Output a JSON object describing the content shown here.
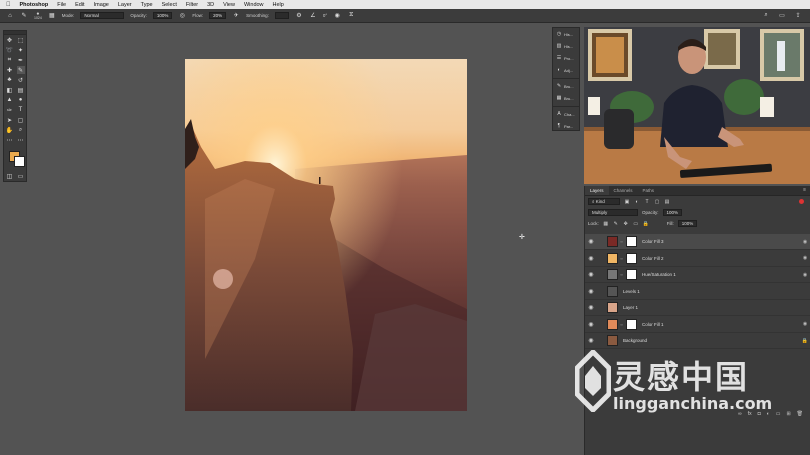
{
  "menubar": {
    "app": "Photoshop",
    "items": [
      "File",
      "Edit",
      "Image",
      "Layer",
      "Type",
      "Select",
      "Filter",
      "3D",
      "View",
      "Window",
      "Help"
    ]
  },
  "options": {
    "brush_size": "1024",
    "mode_label": "Mode:",
    "mode_value": "Normal",
    "opacity_label": "Opacity:",
    "opacity_value": "100%",
    "flow_label": "Flow:",
    "flow_value": "20%",
    "smoothing_label": "Smoothing:",
    "angle_value": "0°"
  },
  "colors": {
    "foreground": "#e9a94e",
    "background": "#ffffff",
    "ui_dark": "#3b3b3b"
  },
  "mini_panel": {
    "items": [
      "His...",
      "His...",
      "Pro...",
      "Adj...",
      "Bru...",
      "Bru...",
      "Cha...",
      "Par..."
    ]
  },
  "layers_panel": {
    "tabs": [
      "Layers",
      "Channels",
      "Paths"
    ],
    "filter_kind": "Kind",
    "blend_mode": "Multiply",
    "opacity_label": "Opacity:",
    "opacity_value": "100%",
    "lock_label": "Lock:",
    "fill_label": "Fill:",
    "fill_value": "100%",
    "layers": [
      {
        "name": "Color Fill 3",
        "thumb": "#7a2a26",
        "mask": true,
        "selected": true
      },
      {
        "name": "Color Fill 2",
        "thumb": "#f0b664",
        "mask": true,
        "selected": false
      },
      {
        "name": "Hue/Saturation 1",
        "thumb": "#777777",
        "mask": true,
        "selected": false
      },
      {
        "name": "Levels 1",
        "thumb": "#555555",
        "mask": false,
        "selected": false
      },
      {
        "name": "Layer 1",
        "thumb": "#d9a58a",
        "mask": false,
        "selected": false
      },
      {
        "name": "Color Fill 1",
        "thumb": "#e08a5a",
        "mask": true,
        "selected": false
      },
      {
        "name": "Background",
        "thumb": "#8a5a40",
        "mask": false,
        "selected": false
      }
    ]
  },
  "watermark": {
    "chinese": "灵感中国",
    "url": "lingganchina.com"
  }
}
